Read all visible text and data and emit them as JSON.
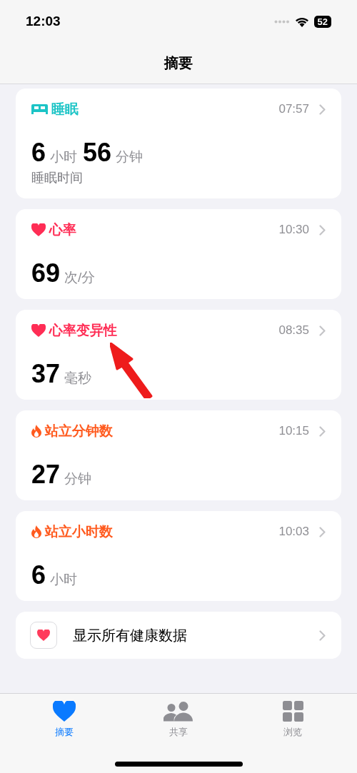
{
  "status_bar": {
    "time": "12:03",
    "battery": "52"
  },
  "nav": {
    "title": "摘要"
  },
  "cards": [
    {
      "kind": "sleep",
      "color": "#1cc4c6",
      "title": "睡眠",
      "time": "07:57",
      "value": [
        {
          "kind": "number",
          "text": "6"
        },
        {
          "kind": "unit",
          "text": "小时"
        },
        {
          "kind": "number",
          "text": "56"
        },
        {
          "kind": "unit",
          "text": "分钟"
        }
      ],
      "subtitle": "睡眠时间"
    },
    {
      "kind": "heart",
      "color": "#ff2d55",
      "title": "心率",
      "time": "10:30",
      "value": [
        {
          "kind": "number",
          "text": "69"
        },
        {
          "kind": "unit",
          "text": "次/分"
        }
      ]
    },
    {
      "kind": "heart",
      "color": "#ff2d55",
      "title": "心率变异性",
      "time": "08:35",
      "value": [
        {
          "kind": "number",
          "text": "37"
        },
        {
          "kind": "unit",
          "text": "毫秒"
        }
      ]
    },
    {
      "kind": "activity",
      "color": "#ff5a1e",
      "title": "站立分钟数",
      "time": "10:15",
      "value": [
        {
          "kind": "number",
          "text": "27"
        },
        {
          "kind": "unit",
          "text": "分钟"
        }
      ]
    },
    {
      "kind": "activity",
      "color": "#ff5a1e",
      "title": "站立小时数",
      "time": "10:03",
      "value": [
        {
          "kind": "number",
          "text": "6"
        },
        {
          "kind": "unit",
          "text": "小时"
        }
      ]
    }
  ],
  "show_all": {
    "label": "显示所有健康数据"
  },
  "annotation": {
    "kind": "arrow"
  },
  "tabs": [
    {
      "label": "摘要",
      "selected": true
    },
    {
      "label": "共享",
      "selected": false
    },
    {
      "label": "浏览",
      "selected": false
    }
  ]
}
